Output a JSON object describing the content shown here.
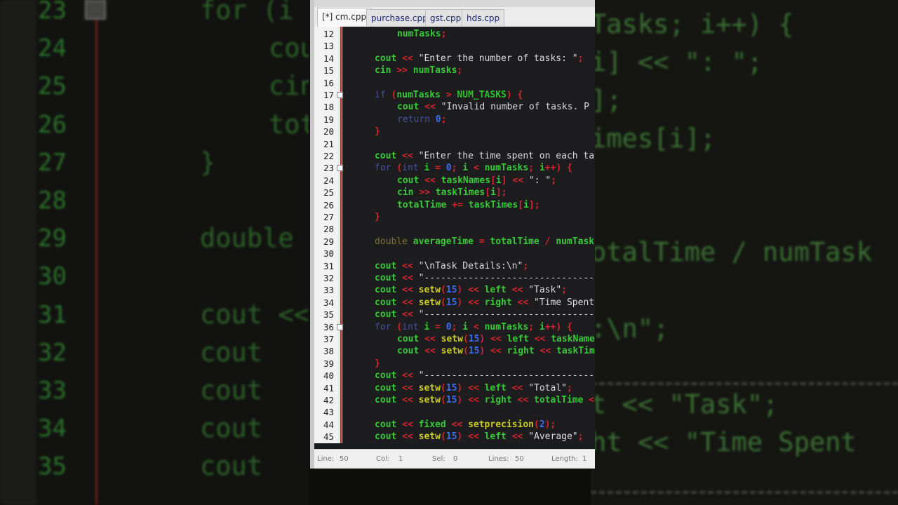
{
  "editor": {
    "tabs": [
      {
        "label": "[*] cm.cpp",
        "active": true
      },
      {
        "label": "purchase.cpp",
        "active": false
      },
      {
        "label": "gst.cpp",
        "active": false
      },
      {
        "label": "hds.cpp",
        "active": false
      }
    ],
    "lines": [
      {
        "n": "12",
        "fold": false,
        "indent": 78,
        "toks": [
          [
            "numTasks",
            "id"
          ],
          [
            ";",
            "op"
          ]
        ]
      },
      {
        "n": "13",
        "fold": false,
        "indent": 46,
        "toks": []
      },
      {
        "n": "14",
        "fold": false,
        "indent": 46,
        "toks": [
          [
            "cout ",
            "id"
          ],
          [
            "<< ",
            "op"
          ],
          [
            "\"Enter the number of tasks: \"",
            "str"
          ],
          [
            ";",
            "op"
          ]
        ]
      },
      {
        "n": "15",
        "fold": false,
        "indent": 46,
        "toks": [
          [
            "cin ",
            "id"
          ],
          [
            ">> ",
            "op"
          ],
          [
            "numTasks",
            "id"
          ],
          [
            ";",
            "op"
          ]
        ]
      },
      {
        "n": "16",
        "fold": false,
        "indent": 46,
        "toks": []
      },
      {
        "n": "17",
        "fold": true,
        "indent": 46,
        "toks": [
          [
            "if ",
            "kw"
          ],
          [
            "(",
            "op"
          ],
          [
            "numTasks ",
            "id"
          ],
          [
            "> ",
            "op"
          ],
          [
            "NUM_TASKS",
            "mac"
          ],
          [
            ") {",
            "op"
          ]
        ]
      },
      {
        "n": "18",
        "fold": false,
        "indent": 78,
        "toks": [
          [
            "cout ",
            "id"
          ],
          [
            "<< ",
            "op"
          ],
          [
            "\"Invalid number of tasks. P",
            "str"
          ]
        ]
      },
      {
        "n": "19",
        "fold": false,
        "indent": 78,
        "toks": [
          [
            "return ",
            "kw"
          ],
          [
            "0",
            "num"
          ],
          [
            ";",
            "op"
          ]
        ]
      },
      {
        "n": "20",
        "fold": false,
        "indent": 46,
        "toks": [
          [
            "}",
            "op"
          ]
        ]
      },
      {
        "n": "21",
        "fold": false,
        "indent": 46,
        "toks": []
      },
      {
        "n": "22",
        "fold": false,
        "indent": 46,
        "toks": [
          [
            "cout ",
            "id"
          ],
          [
            "<< ",
            "op"
          ],
          [
            "\"Enter the time spent on each ta",
            "str"
          ]
        ]
      },
      {
        "n": "23",
        "fold": true,
        "indent": 46,
        "toks": [
          [
            "for ",
            "kw"
          ],
          [
            "(",
            "op"
          ],
          [
            "int ",
            "kw"
          ],
          [
            "i ",
            "id"
          ],
          [
            "= ",
            "op"
          ],
          [
            "0",
            "num"
          ],
          [
            "; ",
            "op"
          ],
          [
            "i ",
            "id"
          ],
          [
            "< ",
            "op"
          ],
          [
            "numTasks",
            "id"
          ],
          [
            "; ",
            "op"
          ],
          [
            "i",
            "id"
          ],
          [
            "++) {",
            "op"
          ]
        ]
      },
      {
        "n": "24",
        "fold": false,
        "indent": 78,
        "toks": [
          [
            "cout ",
            "id"
          ],
          [
            "<< ",
            "op"
          ],
          [
            "taskNames",
            "id"
          ],
          [
            "[",
            "op"
          ],
          [
            "i",
            "id"
          ],
          [
            "] ",
            "op"
          ],
          [
            "<< ",
            "op"
          ],
          [
            "\": \"",
            "str"
          ],
          [
            ";",
            "op"
          ]
        ]
      },
      {
        "n": "25",
        "fold": false,
        "indent": 78,
        "toks": [
          [
            "cin ",
            "id"
          ],
          [
            ">> ",
            "op"
          ],
          [
            "taskTimes",
            "id"
          ],
          [
            "[",
            "op"
          ],
          [
            "i",
            "id"
          ],
          [
            "];",
            "op"
          ]
        ]
      },
      {
        "n": "26",
        "fold": false,
        "indent": 78,
        "toks": [
          [
            "totalTime ",
            "id"
          ],
          [
            "+= ",
            "op"
          ],
          [
            "taskTimes",
            "id"
          ],
          [
            "[",
            "op"
          ],
          [
            "i",
            "id"
          ],
          [
            "];",
            "op"
          ]
        ]
      },
      {
        "n": "27",
        "fold": false,
        "indent": 46,
        "toks": [
          [
            "}",
            "op"
          ]
        ]
      },
      {
        "n": "28",
        "fold": false,
        "indent": 46,
        "toks": []
      },
      {
        "n": "29",
        "fold": false,
        "indent": 46,
        "toks": [
          [
            "double ",
            "type"
          ],
          [
            "averageTime ",
            "id"
          ],
          [
            "= ",
            "op"
          ],
          [
            "totalTime ",
            "id"
          ],
          [
            "/ ",
            "op"
          ],
          [
            "numTask",
            "id"
          ]
        ]
      },
      {
        "n": "30",
        "fold": false,
        "indent": 46,
        "toks": []
      },
      {
        "n": "31",
        "fold": false,
        "indent": 46,
        "toks": [
          [
            "cout ",
            "id"
          ],
          [
            "<< ",
            "op"
          ],
          [
            "\"\\nTask Details:\\n\"",
            "str"
          ],
          [
            ";",
            "op"
          ]
        ]
      },
      {
        "n": "32",
        "fold": false,
        "indent": 46,
        "toks": [
          [
            "cout ",
            "id"
          ],
          [
            "<< ",
            "op"
          ],
          [
            "\"---------------------------------",
            "str"
          ]
        ]
      },
      {
        "n": "33",
        "fold": false,
        "indent": 46,
        "toks": [
          [
            "cout ",
            "id"
          ],
          [
            "<< ",
            "op"
          ],
          [
            "setw",
            "func"
          ],
          [
            "(",
            "op"
          ],
          [
            "15",
            "num"
          ],
          [
            ") ",
            "op"
          ],
          [
            "<< ",
            "op"
          ],
          [
            "left ",
            "id"
          ],
          [
            "<< ",
            "op"
          ],
          [
            "\"Task\"",
            "str"
          ],
          [
            ";",
            "op"
          ]
        ]
      },
      {
        "n": "34",
        "fold": false,
        "indent": 46,
        "toks": [
          [
            "cout ",
            "id"
          ],
          [
            "<< ",
            "op"
          ],
          [
            "setw",
            "func"
          ],
          [
            "(",
            "op"
          ],
          [
            "15",
            "num"
          ],
          [
            ") ",
            "op"
          ],
          [
            "<< ",
            "op"
          ],
          [
            "right ",
            "id"
          ],
          [
            "<< ",
            "op"
          ],
          [
            "\"Time Spent",
            "str"
          ]
        ]
      },
      {
        "n": "35",
        "fold": false,
        "indent": 46,
        "toks": [
          [
            "cout ",
            "id"
          ],
          [
            "<< ",
            "op"
          ],
          [
            "\"---------------------------------",
            "str"
          ]
        ]
      },
      {
        "n": "36",
        "fold": true,
        "indent": 46,
        "toks": [
          [
            "for ",
            "kw"
          ],
          [
            "(",
            "op"
          ],
          [
            "int ",
            "kw"
          ],
          [
            "i ",
            "id"
          ],
          [
            "= ",
            "op"
          ],
          [
            "0",
            "num"
          ],
          [
            "; ",
            "op"
          ],
          [
            "i ",
            "id"
          ],
          [
            "< ",
            "op"
          ],
          [
            "numTasks",
            "id"
          ],
          [
            "; ",
            "op"
          ],
          [
            "i",
            "id"
          ],
          [
            "++) {",
            "op"
          ]
        ]
      },
      {
        "n": "37",
        "fold": false,
        "indent": 78,
        "toks": [
          [
            "cout ",
            "id"
          ],
          [
            "<< ",
            "op"
          ],
          [
            "setw",
            "func"
          ],
          [
            "(",
            "op"
          ],
          [
            "15",
            "num"
          ],
          [
            ") ",
            "op"
          ],
          [
            "<< ",
            "op"
          ],
          [
            "left ",
            "id"
          ],
          [
            "<< ",
            "op"
          ],
          [
            "taskNames",
            "id"
          ]
        ]
      },
      {
        "n": "38",
        "fold": false,
        "indent": 78,
        "toks": [
          [
            "cout ",
            "id"
          ],
          [
            "<< ",
            "op"
          ],
          [
            "setw",
            "func"
          ],
          [
            "(",
            "op"
          ],
          [
            "15",
            "num"
          ],
          [
            ") ",
            "op"
          ],
          [
            "<< ",
            "op"
          ],
          [
            "right ",
            "id"
          ],
          [
            "<< ",
            "op"
          ],
          [
            "taskTimes",
            "id"
          ]
        ]
      },
      {
        "n": "39",
        "fold": false,
        "indent": 46,
        "toks": [
          [
            "}",
            "op"
          ]
        ]
      },
      {
        "n": "40",
        "fold": false,
        "indent": 46,
        "toks": [
          [
            "cout ",
            "id"
          ],
          [
            "<< ",
            "op"
          ],
          [
            "\"---------------------------------",
            "str"
          ]
        ]
      },
      {
        "n": "41",
        "fold": false,
        "indent": 46,
        "toks": [
          [
            "cout ",
            "id"
          ],
          [
            "<< ",
            "op"
          ],
          [
            "setw",
            "func"
          ],
          [
            "(",
            "op"
          ],
          [
            "15",
            "num"
          ],
          [
            ") ",
            "op"
          ],
          [
            "<< ",
            "op"
          ],
          [
            "left ",
            "id"
          ],
          [
            "<< ",
            "op"
          ],
          [
            "\"Total\"",
            "str"
          ],
          [
            ";",
            "op"
          ]
        ]
      },
      {
        "n": "42",
        "fold": false,
        "indent": 46,
        "toks": [
          [
            "cout ",
            "id"
          ],
          [
            "<< ",
            "op"
          ],
          [
            "setw",
            "func"
          ],
          [
            "(",
            "op"
          ],
          [
            "15",
            "num"
          ],
          [
            ") ",
            "op"
          ],
          [
            "<< ",
            "op"
          ],
          [
            "right ",
            "id"
          ],
          [
            "<< ",
            "op"
          ],
          [
            "totalTime ",
            "id"
          ],
          [
            "<<",
            "op"
          ]
        ]
      },
      {
        "n": "43",
        "fold": false,
        "indent": 46,
        "toks": []
      },
      {
        "n": "44",
        "fold": false,
        "indent": 46,
        "toks": [
          [
            "cout ",
            "id"
          ],
          [
            "<< ",
            "op"
          ],
          [
            "fixed ",
            "id"
          ],
          [
            "<< ",
            "op"
          ],
          [
            "setprecision",
            "func"
          ],
          [
            "(",
            "op"
          ],
          [
            "2",
            "num"
          ],
          [
            ");",
            "op"
          ]
        ]
      },
      {
        "n": "45",
        "fold": false,
        "indent": 46,
        "toks": [
          [
            "cout ",
            "id"
          ],
          [
            "<< ",
            "op"
          ],
          [
            "setw",
            "func"
          ],
          [
            "(",
            "op"
          ],
          [
            "15",
            "num"
          ],
          [
            ") ",
            "op"
          ],
          [
            "<< ",
            "op"
          ],
          [
            "left ",
            "id"
          ],
          [
            "<< ",
            "op"
          ],
          [
            "\"Average\"",
            "str"
          ],
          [
            ";",
            "op"
          ]
        ]
      }
    ],
    "status": {
      "line_label": "Line:",
      "line_value": "50",
      "col_label": "Col:",
      "col_value": "1",
      "sel_label": "Sel:",
      "sel_value": "0",
      "lines_label": "Lines:",
      "lines_value": "50",
      "length_label": "Length:",
      "length_value": "1"
    }
  },
  "background": {
    "left_numbers": [
      "23",
      "24",
      "25",
      "26",
      "27",
      "28",
      "29",
      "30",
      "31",
      "32",
      "33",
      "34",
      "35"
    ],
    "left_code": [
      "for (i",
      "cou",
      "cin",
      "tot",
      "}",
      "",
      "double",
      "",
      "cout <<",
      "cout",
      "cout",
      "cout",
      "cout"
    ],
    "right_code": [
      "Tasks; i++) {",
      "i] << \": \";",
      "];",
      "imes[i];",
      "",
      "",
      "otalTime / numTask",
      "",
      ":\\n\";",
      "",
      "t << \"Task\";",
      "ht << \"Time Spent",
      ""
    ]
  },
  "colors": {
    "id": "#37c936",
    "str": "#dcdcdc",
    "op": "#d8242b",
    "kw": "#4453a0",
    "num": "#3b6cf2",
    "func": "#cccc22",
    "type": "#7a7330",
    "mac": "#2dbf2a"
  }
}
